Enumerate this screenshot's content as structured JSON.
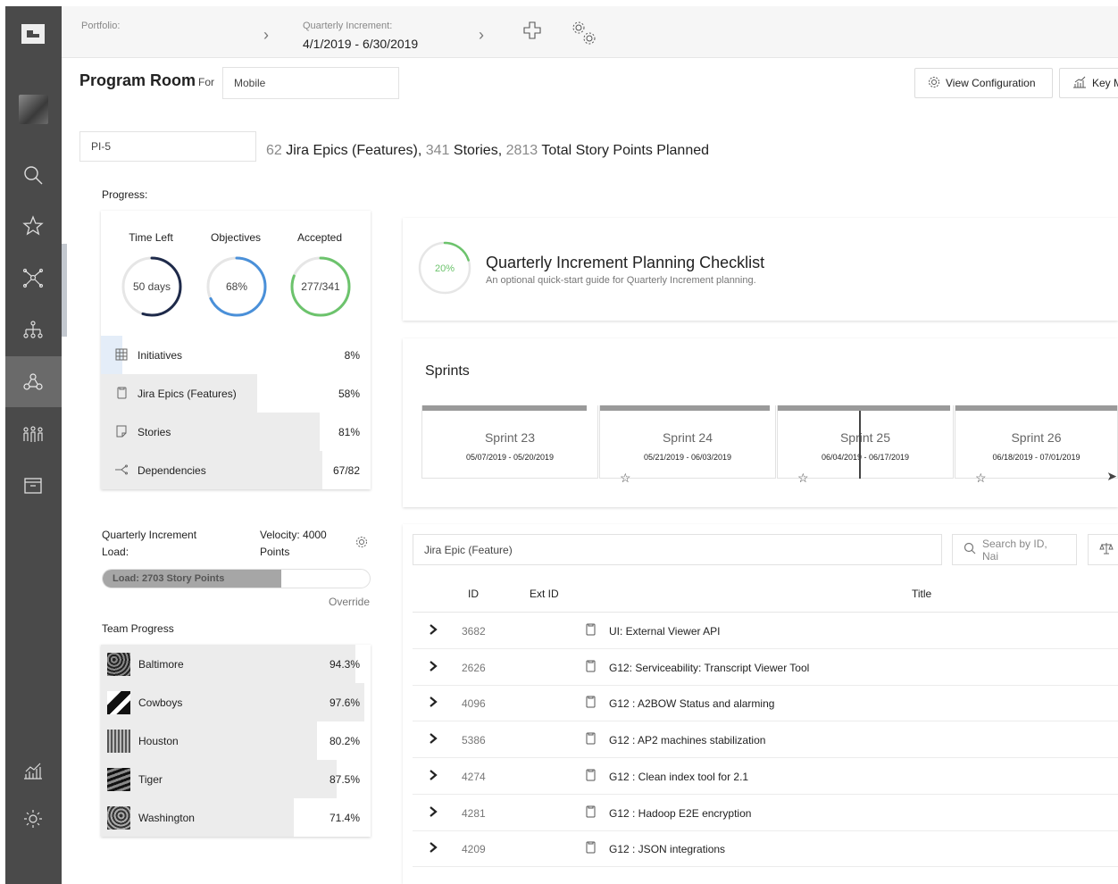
{
  "topbar": {
    "portfolio_label": "Portfolio:",
    "portfolio_value": "",
    "increment_label": "Quarterly Increment:",
    "increment_value": "4/1/2019 - 6/30/2019"
  },
  "header": {
    "title": "Program Room",
    "for_label": "For",
    "team_value": "Mobile",
    "buttons": {
      "view_config": "View Configuration",
      "key_metrics": "Key M"
    }
  },
  "pi": {
    "value": "PI-5"
  },
  "summary": {
    "epics_count": "62",
    "epics_label": "Jira Epics (Features),",
    "stories_count": "341",
    "stories_label": "Stories,",
    "points_count": "2813",
    "points_label": "Total Story Points Planned"
  },
  "progress": {
    "label": "Progress:",
    "gauges": [
      {
        "label": "Time Left",
        "value": "50 days",
        "fraction": 0.55,
        "color": "#1e2a4a"
      },
      {
        "label": "Objectives",
        "value": "68%",
        "fraction": 0.68,
        "color": "#4a90d9"
      },
      {
        "label": "Accepted",
        "value": "277/341",
        "fraction": 0.81,
        "color": "#6cc36c"
      }
    ],
    "rows": [
      {
        "icon": "grid-icon",
        "label": "Initiatives",
        "value": "8%",
        "fraction": 0.08
      },
      {
        "icon": "document-icon",
        "label": "Jira Epics (Features)",
        "value": "58%",
        "fraction": 0.58
      },
      {
        "icon": "story-icon",
        "label": "Stories",
        "value": "81%",
        "fraction": 0.81
      },
      {
        "icon": "dependency-icon",
        "label": "Dependencies",
        "value": "67/82",
        "fraction": 0.82
      }
    ]
  },
  "load": {
    "title": "Quarterly Increment Load:",
    "velocity": "Velocity: 4000 Points",
    "bar_text": "Load: 2703 Story Points",
    "fraction": 0.67,
    "override": "Override"
  },
  "team_progress": {
    "label": "Team Progress",
    "teams": [
      {
        "name": "Baltimore",
        "value": "94.3%",
        "fraction": 0.943
      },
      {
        "name": "Cowboys",
        "value": "97.6%",
        "fraction": 0.976
      },
      {
        "name": "Houston",
        "value": "80.2%",
        "fraction": 0.802
      },
      {
        "name": "Tiger",
        "value": "87.5%",
        "fraction": 0.875
      },
      {
        "name": "Washington",
        "value": "71.4%",
        "fraction": 0.714
      }
    ]
  },
  "checklist": {
    "percent": "20%",
    "fraction": 0.2,
    "title": "Quarterly Increment Planning Checklist",
    "subtitle": "An optional quick-start guide for Quarterly Increment planning."
  },
  "sprints": {
    "title": "Sprints",
    "items": [
      {
        "name": "Sprint 23",
        "dates": "05/07/2019 - 05/20/2019"
      },
      {
        "name": "Sprint 24",
        "dates": "05/21/2019 - 06/03/2019"
      },
      {
        "name": "Sprint 25",
        "dates": "06/04/2019 - 06/17/2019"
      },
      {
        "name": "Sprint 26",
        "dates": "06/18/2019 - 07/01/2019"
      }
    ]
  },
  "table": {
    "filter_value": "Jira Epic (Feature)",
    "search_placeholder": "Search by ID, Nai",
    "columns": {
      "id": "ID",
      "ext_id": "Ext ID",
      "title": "Title"
    },
    "rows": [
      {
        "id": "3682",
        "title": "UI: External Viewer API"
      },
      {
        "id": "2626",
        "title": "G12: Serviceability: Transcript Viewer Tool"
      },
      {
        "id": "4096",
        "title": "G12 : A2BOW Status and alarming"
      },
      {
        "id": "5386",
        "title": "G12 : AP2 machines stabilization"
      },
      {
        "id": "4274",
        "title": "G12 : Clean index tool for 2.1"
      },
      {
        "id": "4281",
        "title": "G12 : Hadoop E2E encryption"
      },
      {
        "id": "4209",
        "title": "G12 : JSON integrations"
      }
    ]
  }
}
